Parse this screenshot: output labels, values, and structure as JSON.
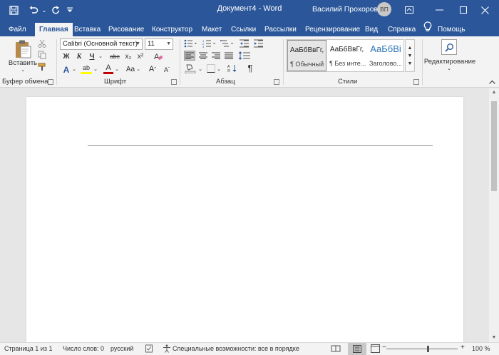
{
  "window": {
    "title": "Документ4 - Word",
    "user_name": "Василий Прохоров",
    "user_initials": "ВП"
  },
  "quick_access": [
    "save-icon",
    "undo-icon",
    "redo-icon",
    "customize-icon"
  ],
  "tabs": [
    {
      "label": "Файл",
      "active": false
    },
    {
      "label": "Главная",
      "active": true
    },
    {
      "label": "Вставка",
      "active": false
    },
    {
      "label": "Рисование",
      "active": false
    },
    {
      "label": "Конструктор",
      "active": false
    },
    {
      "label": "Макет",
      "active": false
    },
    {
      "label": "Ссылки",
      "active": false
    },
    {
      "label": "Рассылки",
      "active": false
    },
    {
      "label": "Рецензирование",
      "active": false
    },
    {
      "label": "Вид",
      "active": false
    },
    {
      "label": "Справка",
      "active": false
    },
    {
      "label": "Помощь",
      "active": false
    }
  ],
  "ribbon": {
    "clipboard": {
      "paste_label": "Вставить",
      "group_label": "Буфер обмена"
    },
    "font": {
      "font_name": "Calibri (Основной текст)",
      "font_size": "11",
      "group_label": "Шрифт",
      "bold": "Ж",
      "italic": "К",
      "underline": "Ч",
      "strike": "abc",
      "subscript": "x₂",
      "superscript": "x²",
      "text_effects": "A",
      "highlight": "ab",
      "font_color": "A",
      "change_case": "Aa",
      "grow": "A",
      "shrink": "A"
    },
    "paragraph": {
      "group_label": "Абзац",
      "show_marks": "¶"
    },
    "styles": {
      "group_label": "Стили",
      "items": [
        {
          "sample": "АаБбВвГг,",
          "name": "¶ Обычный"
        },
        {
          "sample": "АаБбВвГг,",
          "name": "¶ Без инте..."
        },
        {
          "sample": "АаБбВі",
          "name": "Заголово..."
        }
      ]
    },
    "editing": {
      "label": "Редактирование"
    }
  },
  "status": {
    "page": "Страница 1 из 1",
    "words": "Число слов: 0",
    "language": "русский",
    "accessibility": "Специальные возможности: все в порядке",
    "zoom": "100 %",
    "zoom_level": 100
  },
  "colors": {
    "brand": "#2b579a",
    "highlight": "#ffff00",
    "font_color": "#c00000"
  }
}
